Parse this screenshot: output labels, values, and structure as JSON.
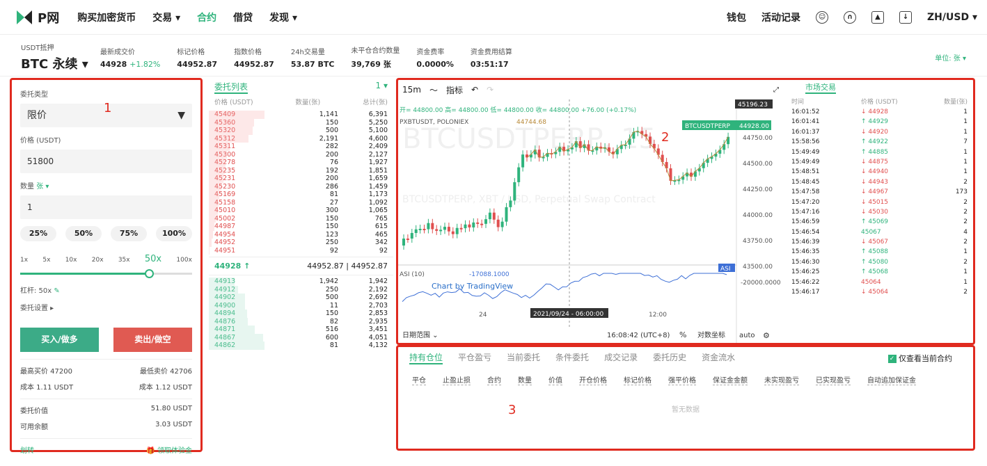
{
  "nav": {
    "logo": "P网",
    "items": [
      "购买加密货币",
      "交易 ▾",
      "合约",
      "借贷",
      "发现 ▾"
    ],
    "active": 2,
    "right": [
      "钱包",
      "活动记录"
    ],
    "locale": "ZH/USD ▾"
  },
  "ticker": {
    "margin": "USDT抵押",
    "symbol": "BTC 永续 ▾",
    "cols": [
      {
        "lab": "最新成交价",
        "val": "44928",
        "chg": "+1.82%"
      },
      {
        "lab": "标记价格",
        "val": "44952.87"
      },
      {
        "lab": "指数价格",
        "val": "44952.87"
      },
      {
        "lab": "24h交易量",
        "val": "53.87 BTC"
      },
      {
        "lab": "未平仓合约数量",
        "val": "39,769 张"
      },
      {
        "lab": "资金费率",
        "val": "0.0000%"
      },
      {
        "lab": "资金费用结算",
        "val": "03:51:17"
      }
    ],
    "unit": "单位: 张 ▾"
  },
  "order": {
    "type_label": "委托类型",
    "type_value": "限价",
    "price_label": "价格 (USDT)",
    "price_value": "51800",
    "qty_label": "数量",
    "qty_unit": "张 ▾",
    "qty_value": "1",
    "pcts": [
      "25%",
      "50%",
      "75%",
      "100%"
    ],
    "levs": [
      "1x",
      "5x",
      "10x",
      "20x",
      "35x",
      "50x",
      "100x"
    ],
    "lev_selected": "50x",
    "lev_fill": 0.75,
    "lev_text": "杠杆: 50x",
    "settings": "委托设置 ▸",
    "buy": "买入/做多",
    "sell": "卖出/做空",
    "max_buy": "最高买价 47200",
    "min_sell": "最低卖价 42706",
    "cost_buy": "成本 1.11 USDT",
    "cost_sell": "成本 1.12 USDT",
    "order_value_lab": "委托价值",
    "order_value": "51.80 USDT",
    "avail_lab": "可用余额",
    "avail": "3.03 USDT",
    "transfer": "划转",
    "bonus": "领取体验金"
  },
  "book": {
    "title": "委托列表",
    "agg": "1 ▾",
    "headers": [
      "价格 (USDT)",
      "数量(张)",
      "总计(张)"
    ],
    "asks": [
      [
        "45409",
        "1,141",
        "6,391"
      ],
      [
        "45360",
        "150",
        "5,250"
      ],
      [
        "45320",
        "500",
        "5,100"
      ],
      [
        "45312",
        "2,191",
        "4,600"
      ],
      [
        "45311",
        "282",
        "2,409"
      ],
      [
        "45300",
        "200",
        "2,127"
      ],
      [
        "45278",
        "76",
        "1,927"
      ],
      [
        "45235",
        "192",
        "1,851"
      ],
      [
        "45231",
        "200",
        "1,659"
      ],
      [
        "45230",
        "286",
        "1,459"
      ],
      [
        "45169",
        "81",
        "1,173"
      ],
      [
        "45158",
        "27",
        "1,092"
      ],
      [
        "45010",
        "300",
        "1,065"
      ],
      [
        "45002",
        "150",
        "765"
      ],
      [
        "44987",
        "150",
        "615"
      ],
      [
        "44954",
        "123",
        "465"
      ],
      [
        "44952",
        "250",
        "342"
      ],
      [
        "44951",
        "92",
        "92"
      ]
    ],
    "mid_price": "44928 ↑",
    "mid_mark": "44952.87",
    "mid_index": "44952.87",
    "bids": [
      [
        "44913",
        "1,942",
        "1,942"
      ],
      [
        "44912",
        "250",
        "2,192"
      ],
      [
        "44902",
        "500",
        "2,692"
      ],
      [
        "44900",
        "11",
        "2,703"
      ],
      [
        "44894",
        "150",
        "2,853"
      ],
      [
        "44876",
        "82",
        "2,935"
      ],
      [
        "44871",
        "516",
        "3,451"
      ],
      [
        "44867",
        "600",
        "4,051"
      ],
      [
        "44862",
        "81",
        "4,132"
      ]
    ]
  },
  "chart": {
    "interval": "15m",
    "indicator": "指标",
    "ohlc": "开= 44800.00 高= 44800.00 低= 44800.00 收= 44800.00 +76.00 (+0.17%)",
    "pair": "PXBTUSDT, POLONIEX",
    "pair_val": "44744.68",
    "watermark": "BTCUSDTPERP, 15",
    "watermark2": "BTCUSDTPERP, XBT / USD, Perpetual Swap Contract",
    "last_label": "BTCUSDTPERP",
    "last_price": "44928.00",
    "high_label": "45196.23",
    "yticks": [
      "44750.00",
      "44500.00",
      "44250.00",
      "44000.00",
      "43750.00",
      "43500.00"
    ],
    "asi": "ASI (10)",
    "asi_val": "-17088.1000",
    "asi_tag": "ASI",
    "asi_tick": "-20000.0000",
    "brand": "Chart by TradingView",
    "xticks": [
      "24",
      "12:00"
    ],
    "crosshair_time": "2021/09/24 - 06:00:00",
    "range": "日期范围 ⌄",
    "time": "16:08:42 (UTC+8)",
    "pct": "%",
    "log": "对数坐标",
    "auto": "auto"
  },
  "trades": {
    "title": "市场交易",
    "headers": [
      "时间",
      "价格 (USDT)",
      "数量(张)"
    ],
    "rows": [
      [
        "16:01:52",
        "↓",
        "44928",
        "1",
        "r"
      ],
      [
        "16:01:41",
        "↑",
        "44929",
        "1",
        "g"
      ],
      [
        "16:01:37",
        "↓",
        "44920",
        "1",
        "r"
      ],
      [
        "15:58:56",
        "↑",
        "44922",
        "7",
        "g"
      ],
      [
        "15:49:49",
        "↑",
        "44885",
        "1",
        "g"
      ],
      [
        "15:49:49",
        "↓",
        "44875",
        "1",
        "r"
      ],
      [
        "15:48:51",
        "↓",
        "44940",
        "1",
        "r"
      ],
      [
        "15:48:45",
        "↓",
        "44943",
        "2",
        "r"
      ],
      [
        "15:47:58",
        "↓",
        "44967",
        "173",
        "r"
      ],
      [
        "15:47:20",
        "↓",
        "45015",
        "2",
        "r"
      ],
      [
        "15:47:16",
        "↓",
        "45030",
        "2",
        "r"
      ],
      [
        "15:46:59",
        "↑",
        "45069",
        "2",
        "g"
      ],
      [
        "15:46:54",
        "",
        "45067",
        "4",
        "g"
      ],
      [
        "15:46:39",
        "↓",
        "45067",
        "2",
        "r"
      ],
      [
        "15:46:35",
        "↑",
        "45088",
        "1",
        "g"
      ],
      [
        "15:46:30",
        "↑",
        "45080",
        "2",
        "g"
      ],
      [
        "15:46:25",
        "↑",
        "45068",
        "1",
        "g"
      ],
      [
        "15:46:22",
        "",
        "45064",
        "1",
        "r"
      ],
      [
        "15:46:17",
        "↓",
        "45064",
        "2",
        "r"
      ]
    ]
  },
  "positions": {
    "tabs": [
      "持有仓位",
      "平仓盈亏",
      "当前委托",
      "条件委托",
      "成交记录",
      "委托历史",
      "资金流水"
    ],
    "only_current": "仅查看当前合约",
    "cols": [
      "平仓",
      "止盈止损",
      "合约",
      "数量",
      "价值",
      "开仓价格",
      "标记价格",
      "强平价格",
      "保证金金额",
      "未实现盈亏",
      "已实现盈亏",
      "自动追加保证金"
    ],
    "empty": "暂无数据"
  },
  "annotations": [
    "1",
    "2",
    "3"
  ]
}
